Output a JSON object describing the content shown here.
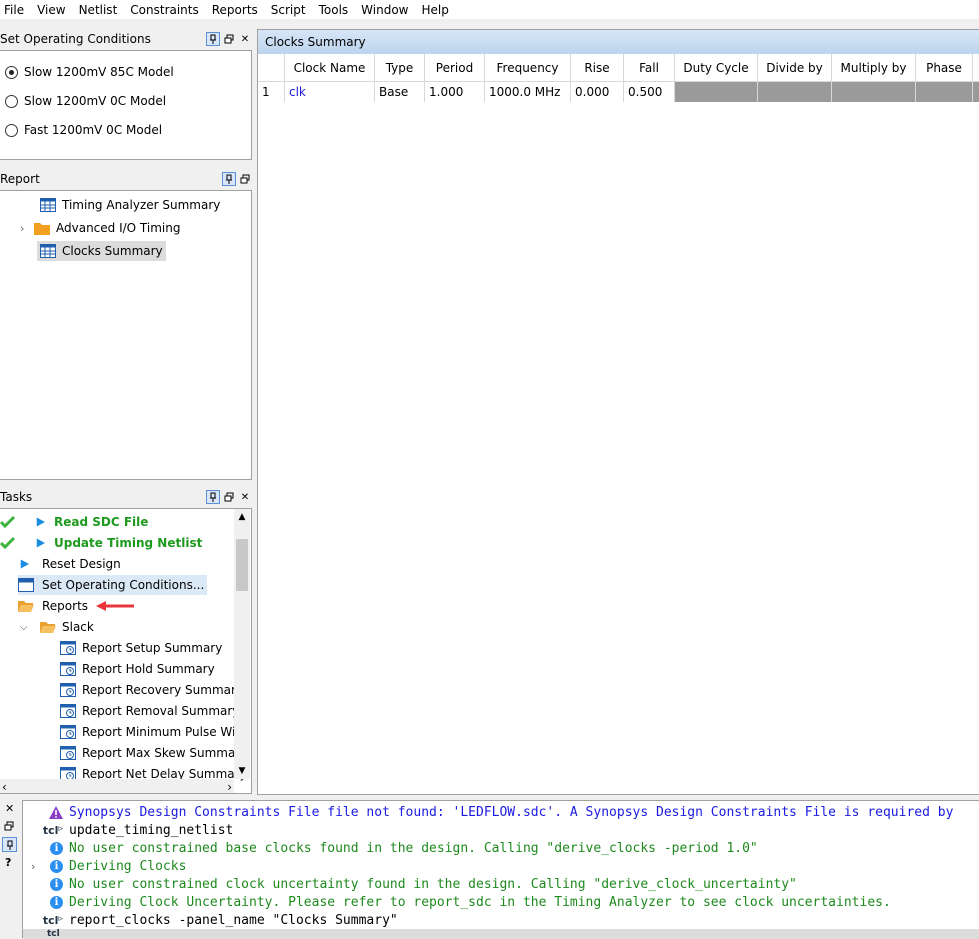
{
  "menu": [
    "File",
    "View",
    "Netlist",
    "Constraints",
    "Reports",
    "Script",
    "Tools",
    "Window",
    "Help"
  ],
  "op_conditions": {
    "title": "Set Operating Conditions",
    "options": [
      {
        "label": "Slow 1200mV 85C Model",
        "selected": true
      },
      {
        "label": "Slow 1200mV 0C Model",
        "selected": false
      },
      {
        "label": "Fast 1200mV 0C Model",
        "selected": false
      }
    ]
  },
  "report": {
    "title": "Report",
    "items": [
      {
        "label": "Timing Analyzer Summary",
        "icon": "table-icon"
      },
      {
        "label": "Advanced I/O Timing",
        "icon": "folder-icon",
        "expandable": true
      },
      {
        "label": "Clocks Summary",
        "icon": "table-icon",
        "selected": true
      }
    ]
  },
  "tasks": {
    "title": "Tasks",
    "items": [
      {
        "label": "Read SDC File",
        "done": true
      },
      {
        "label": "Update Timing Netlist",
        "done": true
      },
      {
        "label": "Reset Design"
      },
      {
        "label": "Set Operating Conditions..."
      },
      {
        "label": "Reports"
      },
      {
        "label": "Slack"
      },
      {
        "label": "Report Setup Summary"
      },
      {
        "label": "Report Hold Summary"
      },
      {
        "label": "Report Recovery Summary"
      },
      {
        "label": "Report Removal Summary"
      },
      {
        "label": "Report Minimum Pulse Widtl"
      },
      {
        "label": "Report Max Skew Summary"
      },
      {
        "label": "Report Net Delay Summary"
      }
    ]
  },
  "clocks": {
    "title": "Clocks Summary",
    "columns": [
      "Clock Name",
      "Type",
      "Period",
      "Frequency",
      "Rise",
      "Fall",
      "Duty Cycle",
      "Divide by",
      "Multiply by",
      "Phase"
    ],
    "rows": [
      {
        "num": "1",
        "cells": [
          "clk",
          "Base",
          "1.000",
          "1000.0 MHz",
          "0.000",
          "0.500",
          "",
          "",
          "",
          ""
        ]
      }
    ]
  },
  "console": {
    "lines": [
      {
        "kind": "warn",
        "text": "Synopsys Design Constraints File file not found: 'LEDFLOW.sdc'. A Synopsys Design Constraints File is required by"
      },
      {
        "kind": "tcl",
        "text": "update_timing_netlist"
      },
      {
        "kind": "info",
        "text": "No user constrained base clocks found in the design. Calling \"derive_clocks -period 1.0\""
      },
      {
        "kind": "info",
        "text": "Deriving Clocks"
      },
      {
        "kind": "info",
        "text": "No user constrained clock uncertainty found in the design. Calling \"derive_clock_uncertainty\""
      },
      {
        "kind": "info",
        "text": "Deriving Clock Uncertainty. Please refer to report_sdc in the Timing Analyzer to see clock uncertainties."
      },
      {
        "kind": "tcl",
        "text": "report_clocks -panel_name \"Clocks Summary\""
      }
    ],
    "prompt_label": "tcl"
  }
}
